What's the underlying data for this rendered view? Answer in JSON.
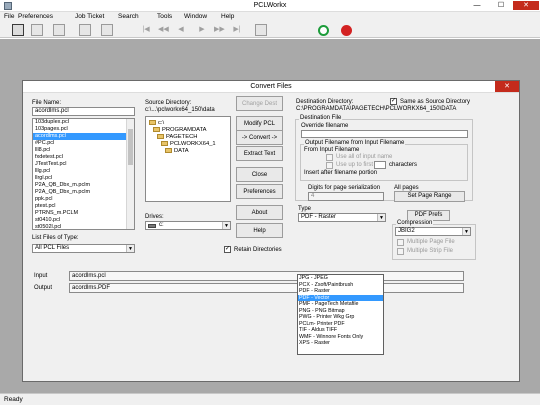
{
  "window": {
    "title": "PCLWorkx",
    "min": "—",
    "max": "☐",
    "close": "✕"
  },
  "menu": [
    "File",
    "Preferences",
    "Job Ticket",
    "Search",
    "Tools",
    "Window",
    "Help"
  ],
  "toolbar": {
    "buttons": [
      "open-icon",
      "print-icon",
      "edit-icon",
      "paste-icon",
      "ticket-icon",
      "first-icon",
      "prev-page-icon",
      "prev-icon",
      "next-icon",
      "next-page-icon",
      "last-icon",
      "refresh-icon",
      "stop-icon"
    ],
    "nav_glyphs": [
      "|◀",
      "◀◀",
      "◀",
      "▶",
      "▶▶",
      "▶|"
    ]
  },
  "status": "Ready",
  "dialog": {
    "title": "Convert Files",
    "close": "✕",
    "file_name_label": "File Name:",
    "file_name_value": "acordlms.pcl",
    "files": [
      "103duplex.pcl",
      "103pages.pcl",
      "acordlms.pcl",
      "#PC.pcl",
      "lll8.pcl",
      "fxdetest.pcl",
      "JTestTest.pcl",
      "lllg.pcl",
      "llrgl.pcl",
      "P2A_QB_Dbx_m.pclm",
      "P2A_QB_Dbx_m.pclm",
      "ppk.pcl",
      "ptest.pcl",
      "PTRNS_m.PCLM",
      "st0410.pcl",
      "st0502l.pcl",
      "support.pcl",
      "test8bit.pm",
      "testcolr.pcl",
      "testcmp.pcl"
    ],
    "selected_file": 2,
    "list_type_label": "List Files of Type:",
    "list_type_value": "All PCL Files",
    "source_dir_label": "Source Directory:",
    "source_dir_value": "c:\\...\\pclworkx64_150\\data",
    "dirs": [
      "c:\\",
      "PROGRAMDATA",
      "PAGETECH",
      "PCLWORKX64_1",
      "DATA"
    ],
    "drives_label": "Drives:",
    "drives_value": "c:",
    "buttons": {
      "change_dest": "Change Dest",
      "modify_pcl": "Modify PCL",
      "convert": "-> Convert ->",
      "extract_text": "Extract Text",
      "close": "Close",
      "preferences": "Preferences",
      "about": "About",
      "help": "Help",
      "set_page_range": "Set Page Range",
      "pdf_prefs": "PDF Prefs"
    },
    "retain_dirs": "Retain Directories",
    "dest_dir_label": "Destination Directory:",
    "same_as_source": "Same as Source Directory",
    "dest_dir_value": "C:\\PROGRAMDATA\\PAGETECH\\PCLWORKX64_150\\DATA",
    "dest_file_label": "Destination File",
    "override_label": "Override filename",
    "output_from_input_label": "Output Filename from Input Filename",
    "from_input_label": "From Input Filename",
    "use_all_input": "Use all of input name",
    "use_up_to_first": "Use up to first",
    "characters": "characters",
    "insert_after": "Insert after filename portion",
    "digits_label": "Digits for page serialization",
    "digits_value": "4",
    "all_pages": "All pages",
    "type_label": "Type",
    "type_value": "PDF - Raster",
    "type_options": [
      "JPG - JPEG",
      "PCX - Zsoft/Paintbrush",
      "PDF - Raster",
      "PDF - Vector",
      "PMF - PageTech Metafile",
      "PNG - PNG Bitmap",
      "PWG - Printer Wkg Grp",
      "PCLm- Printer PDF",
      "TIF - Aldus TIFF",
      "WMF - Winnore Fonts Only",
      "XPS - Raster"
    ],
    "type_selected": 3,
    "compression_label": "Compression",
    "compression_value": "JBIG2",
    "multiple_page_file": "Multiple Page File",
    "multiple_strip_file": "Multiple Strip File",
    "input_label": "Input",
    "input_value": "acordlms.pcl",
    "output_label": "Output",
    "output_value": "acordlms.PDF"
  }
}
